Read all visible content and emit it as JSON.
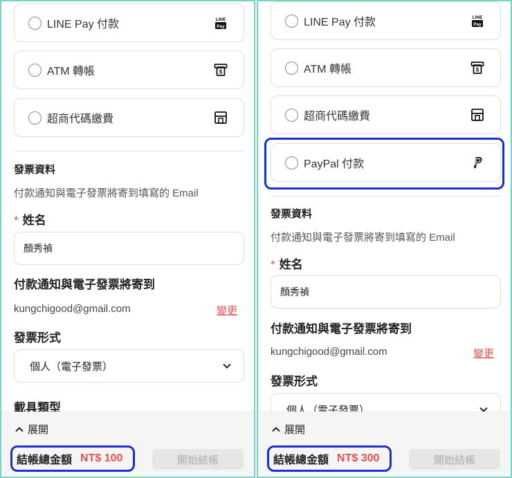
{
  "left": {
    "payment_options": [
      {
        "label": "LINE Pay 付款",
        "icon": "line-pay-icon"
      },
      {
        "label": "ATM 轉帳",
        "icon": "atm-icon"
      },
      {
        "label": "超商代碼繳費",
        "icon": "store-icon"
      }
    ],
    "invoice": {
      "section_title": "發票資料",
      "hint": "付款通知與電子發票將寄到填寫的 Email",
      "name_required_mark": "*",
      "name_label": "姓名",
      "name_value": "顏秀禎",
      "email_title": "付款通知與電子發票將寄到",
      "email": "kungchigood@gmail.com",
      "change_label": "變更",
      "invoice_type_label": "發票形式",
      "invoice_type_value": "個人（電子發票）",
      "carrier_label": "載具類型"
    },
    "footer": {
      "expand_label": "展開",
      "total_label": "結帳總金額",
      "total_amount": "NT$ 100",
      "checkout_label": "開始結帳"
    }
  },
  "right": {
    "payment_options": [
      {
        "label": "LINE Pay 付款",
        "icon": "line-pay-icon"
      },
      {
        "label": "ATM 轉帳",
        "icon": "atm-icon"
      },
      {
        "label": "超商代碼繳費",
        "icon": "store-icon"
      },
      {
        "label": "PayPal 付款",
        "icon": "paypal-icon"
      }
    ],
    "invoice": {
      "section_title": "發票資料",
      "hint": "付款通知與電子發票將寄到填寫的 Email",
      "name_required_mark": "*",
      "name_label": "姓名",
      "name_value": "顏秀禎",
      "email_title": "付款通知與電子發票將寄到",
      "email": "kungchigood@gmail.com",
      "change_label": "變更",
      "invoice_type_label": "發票形式",
      "invoice_type_value": "個人（電子發票）"
    },
    "footer": {
      "expand_label": "展開",
      "total_label": "結帳總金額",
      "total_amount": "NT$ 300",
      "checkout_label": "開始結帳"
    }
  },
  "colors": {
    "panel_border": "#6fd6c8",
    "highlight": "#1a2fd0",
    "accent_red": "#e2504f",
    "disabled_button": "#e6e6e6"
  }
}
